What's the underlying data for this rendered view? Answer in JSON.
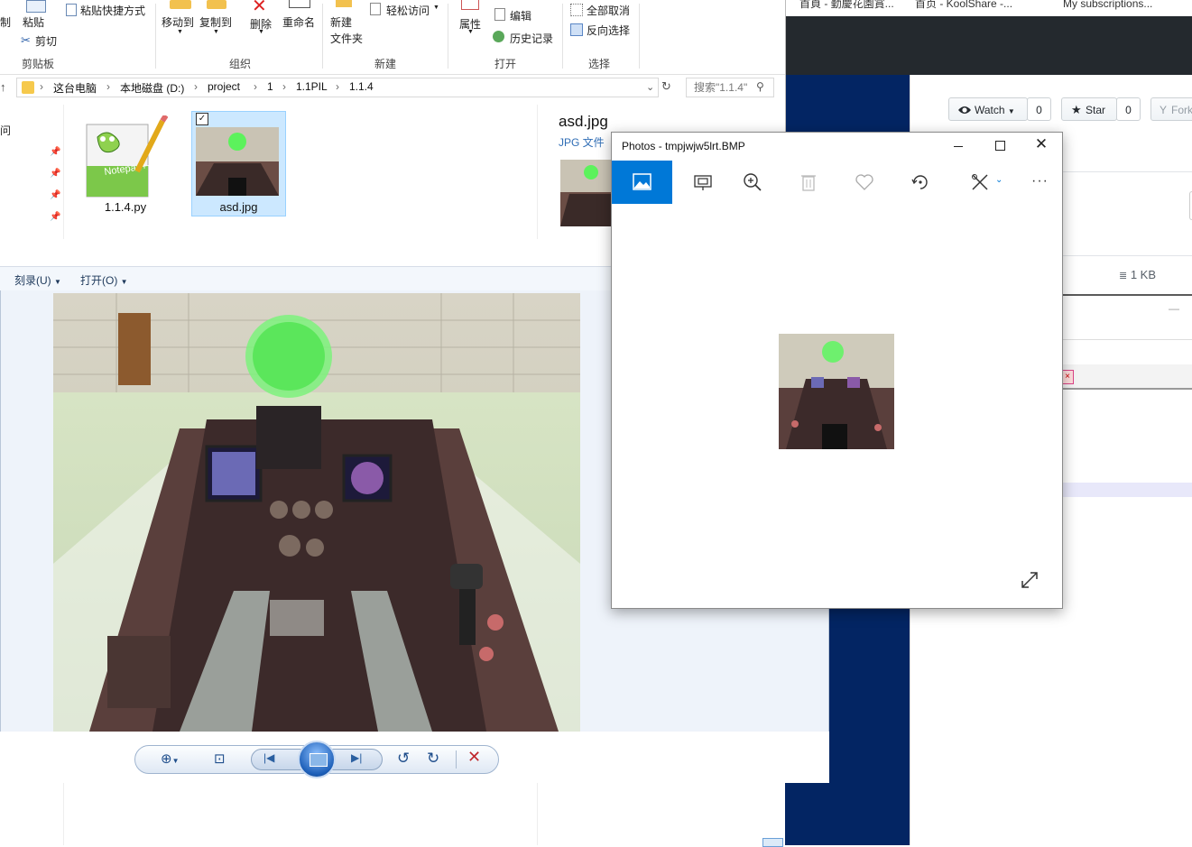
{
  "browser_bg": {
    "bookmarks": [
      "首頁 - 勤慶花園賞...",
      "首页 - KoolShare -...",
      "My subscriptions..."
    ],
    "watch_label": "Watch",
    "watch_count": "0",
    "star_label": "Star",
    "star_count": "0",
    "fork_label": "Fork",
    "size_label": "1 KB"
  },
  "explorer": {
    "ribbon": {
      "clipboard": {
        "paste": "粘贴",
        "paste_shortcut": "粘贴快捷方式",
        "cut": "剪切",
        "group": "剪贴板",
        "copy_path_partial": "制"
      },
      "organize": {
        "move_to": "移动到",
        "copy_to": "复制到",
        "delete": "删除",
        "rename": "重命名",
        "group": "组织"
      },
      "new": {
        "new_folder": "新建\n文件夹",
        "easy_access": "轻松访问",
        "group": "新建"
      },
      "open": {
        "properties": "属性",
        "edit": "编辑",
        "history": "历史记录",
        "group": "打开"
      },
      "select": {
        "select_none": "全部取消",
        "invert": "反向选择",
        "group": "选择"
      }
    },
    "address": {
      "crumbs": [
        "这台电脑",
        "本地磁盘 (D:)",
        "project",
        "1",
        "1.1PIL",
        "1.1.4"
      ]
    },
    "search_placeholder": "搜索\"1.1.4\"",
    "nav_partial": "问",
    "files": [
      {
        "name": "1.1.4.py",
        "icon": "notepadpp-icon"
      },
      {
        "name": "asd.jpg",
        "icon": "image-thumbnail",
        "selected": true
      }
    ],
    "preview": {
      "name": "asd.jpg",
      "type": "JPG 文件"
    }
  },
  "photo_viewer": {
    "menu": [
      "刻录(U)",
      "打开(O)"
    ]
  },
  "photos_app": {
    "title": "Photos - tmpjwjw5lrt.BMP",
    "toolbar": [
      "picture-icon",
      "slideshow-icon",
      "zoom-in-icon",
      "delete-icon",
      "heart-icon",
      "rotate-icon",
      "edit-icon",
      "more-icon"
    ]
  },
  "colors": {
    "accent": "#0078d7",
    "navy": "#032563",
    "dark_header": "#24292e",
    "close_red": "#c42b1c"
  }
}
